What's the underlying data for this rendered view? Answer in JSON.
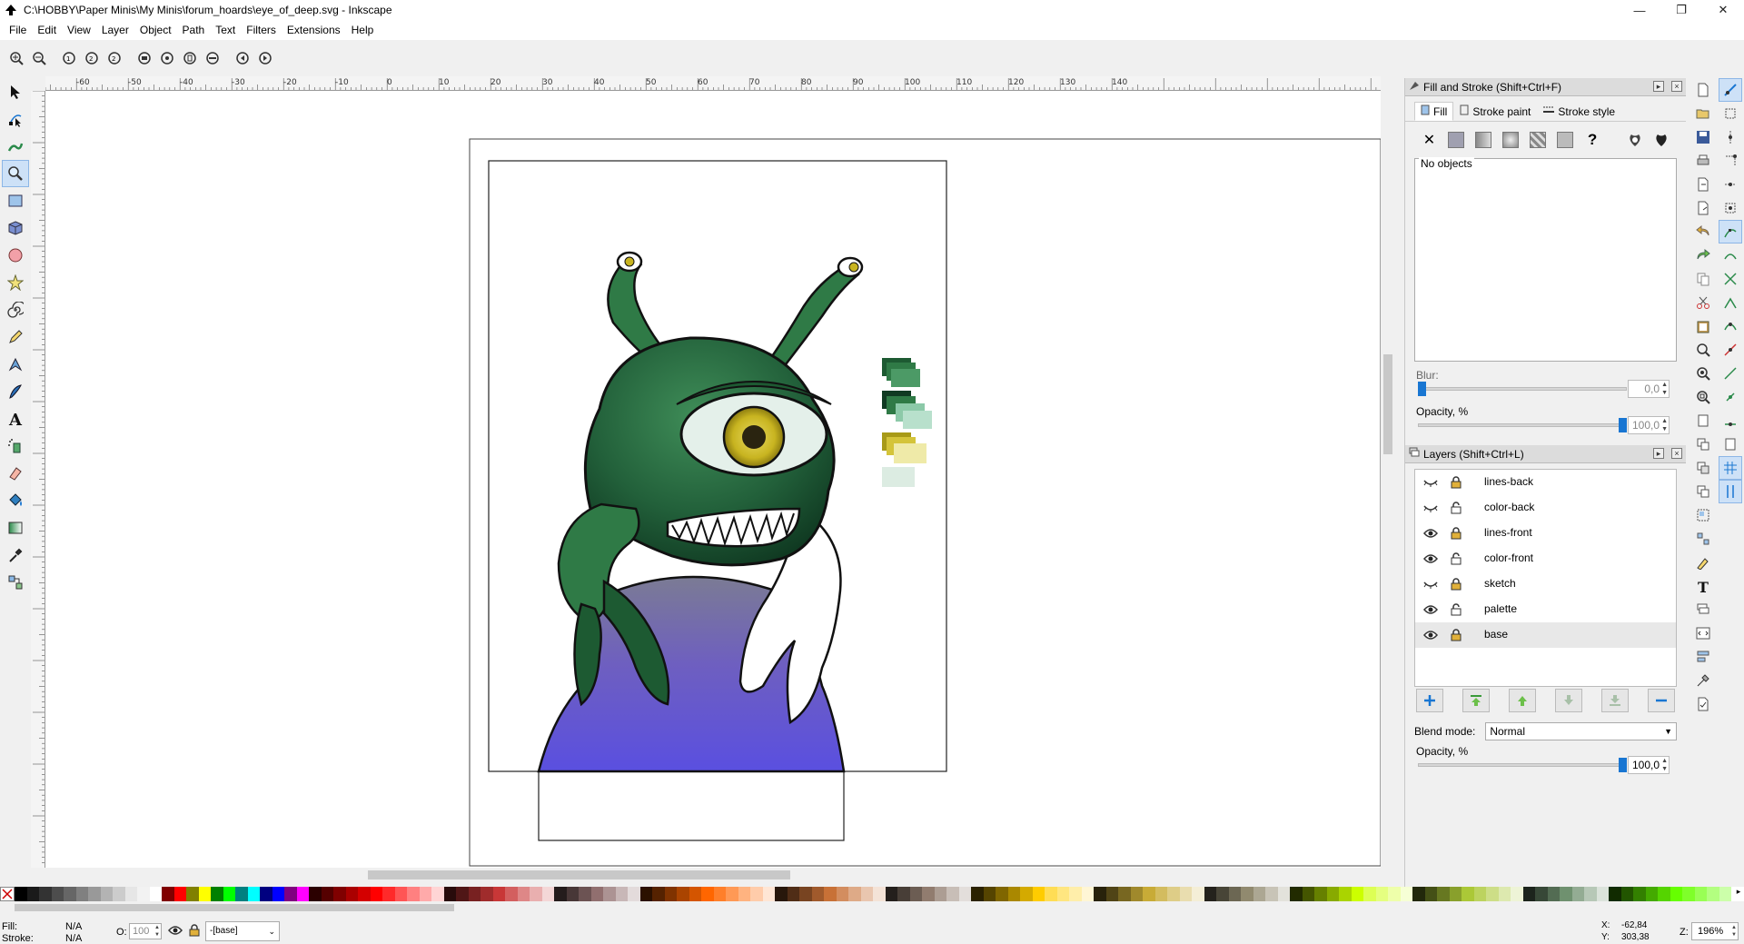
{
  "window": {
    "title": "C:\\HOBBY\\Paper Minis\\My Minis\\forum_hoards\\eye_of_deep.svg - Inkscape",
    "minimize": "—",
    "maximize": "❐",
    "close": "✕"
  },
  "menu": [
    "File",
    "Edit",
    "View",
    "Layer",
    "Object",
    "Path",
    "Text",
    "Filters",
    "Extensions",
    "Help"
  ],
  "fill_stroke": {
    "title": "Fill and Stroke (Shift+Ctrl+F)",
    "tabs": [
      "Fill",
      "Stroke paint",
      "Stroke style"
    ],
    "no_objects": "No objects",
    "blur_label": "Blur:",
    "blur_value": "0,0",
    "blur_percent": 0,
    "opacity_label": "Opacity, %",
    "opacity_value": "100,0",
    "opacity_percent": 100
  },
  "layers_panel": {
    "title": "Layers (Shift+Ctrl+L)",
    "layers": [
      {
        "name": "lines-back",
        "visible": false,
        "locked": true
      },
      {
        "name": "color-back",
        "visible": false,
        "locked": false
      },
      {
        "name": "lines-front",
        "visible": true,
        "locked": true
      },
      {
        "name": "color-front",
        "visible": true,
        "locked": false
      },
      {
        "name": "sketch",
        "visible": false,
        "locked": true
      },
      {
        "name": "palette",
        "visible": true,
        "locked": false
      },
      {
        "name": "base",
        "visible": true,
        "locked": true
      }
    ],
    "selected": "base",
    "blend_label": "Blend mode:",
    "blend_value": "Normal",
    "opacity_label": "Opacity, %",
    "opacity_value": "100,0",
    "opacity_percent": 100
  },
  "ruler": {
    "h_labels": [
      "-60",
      "-50",
      "-40",
      "-30",
      "-20",
      "-10",
      "0",
      "10",
      "20",
      "30",
      "40",
      "50",
      "60",
      "70",
      "80",
      "90",
      "100",
      "110",
      "120",
      "130",
      "140"
    ]
  },
  "statusbar": {
    "fill_label": "Fill:",
    "fill_value": "N/A",
    "stroke_label": "Stroke:",
    "stroke_value": "N/A",
    "opacity_label": "O:",
    "opacity_value": "100",
    "layer_value": "-[base]",
    "x_label": "X:",
    "x_value": "-62,84",
    "y_label": "Y:",
    "y_value": "303,38",
    "zoom_label": "Z:",
    "zoom_value": "196%"
  },
  "colors": {
    "accent": "#1976d2",
    "monster_dark": "#1d5a32",
    "monster_mid": "#2f7a46",
    "robe_top": "#6a6a8a",
    "robe_bottom": "#5a4fe0",
    "eye_yellow": "#c8b420"
  },
  "palette": [
    "#000000",
    "#1a1a1a",
    "#333333",
    "#4d4d4d",
    "#666666",
    "#808080",
    "#999999",
    "#b3b3b3",
    "#cccccc",
    "#e6e6e6",
    "#f2f2f2",
    "#ffffff",
    "#800000",
    "#ff0000",
    "#808000",
    "#ffff00",
    "#008000",
    "#00ff00",
    "#008080",
    "#00ffff",
    "#000080",
    "#0000ff",
    "#800080",
    "#ff00ff",
    "#2b0000",
    "#550000",
    "#800000",
    "#aa0000",
    "#d40000",
    "#ff0000",
    "#ff2a2a",
    "#ff5555",
    "#ff8080",
    "#ffaaaa",
    "#ffd5d5",
    "#280b0b",
    "#501616",
    "#782121",
    "#a02c2c",
    "#c83737",
    "#d35f5f",
    "#de8787",
    "#e9afaf",
    "#f4d7d7",
    "#241c1c",
    "#483737",
    "#6c5353",
    "#916f6f",
    "#ac9393",
    "#c8b7b7",
    "#e3dbdb",
    "#2b1100",
    "#552200",
    "#803300",
    "#aa4400",
    "#d45500",
    "#ff6600",
    "#ff7f2a",
    "#ff9955",
    "#ffb380",
    "#ffccaa",
    "#ffe6d5",
    "#28170b",
    "#502d16",
    "#784421",
    "#a05a2c",
    "#c87137",
    "#d38d5f",
    "#deaa87",
    "#e9c6af",
    "#f4e3d7",
    "#241f1c",
    "#483e37",
    "#6c5d53",
    "#917c6f",
    "#ac9d93",
    "#c8beb7",
    "#e3dedb",
    "#2b2200",
    "#554400",
    "#806600",
    "#aa8800",
    "#d4aa00",
    "#ffcc00",
    "#ffdd55",
    "#ffe680",
    "#ffeeaa",
    "#fff6d5",
    "#28220b",
    "#504416",
    "#786721",
    "#a0892c",
    "#c8ab37",
    "#d3bc5f",
    "#decd87",
    "#e9ddaf",
    "#f4eed7",
    "#24221c",
    "#484537",
    "#6c6753",
    "#918a6f",
    "#aca793",
    "#c8c4b7",
    "#e3e2db",
    "#222b00",
    "#445500",
    "#668000",
    "#88aa00",
    "#aad400",
    "#ccff00",
    "#ddff55",
    "#e5ff80",
    "#eeffaa",
    "#f6ffd5",
    "#22280b",
    "#445016",
    "#677821",
    "#89a02c",
    "#abc837",
    "#bcd35f",
    "#cdde87",
    "#dde9af",
    "#eef4d7",
    "#1c241c",
    "#374837",
    "#536c53",
    "#6f916f",
    "#93ac93",
    "#b7c8b7",
    "#dbe3db",
    "#112b00",
    "#225500",
    "#338000",
    "#44aa00",
    "#55d400",
    "#66ff00",
    "#7fff2a",
    "#99ff55",
    "#b3ff80",
    "#ccffaa"
  ]
}
